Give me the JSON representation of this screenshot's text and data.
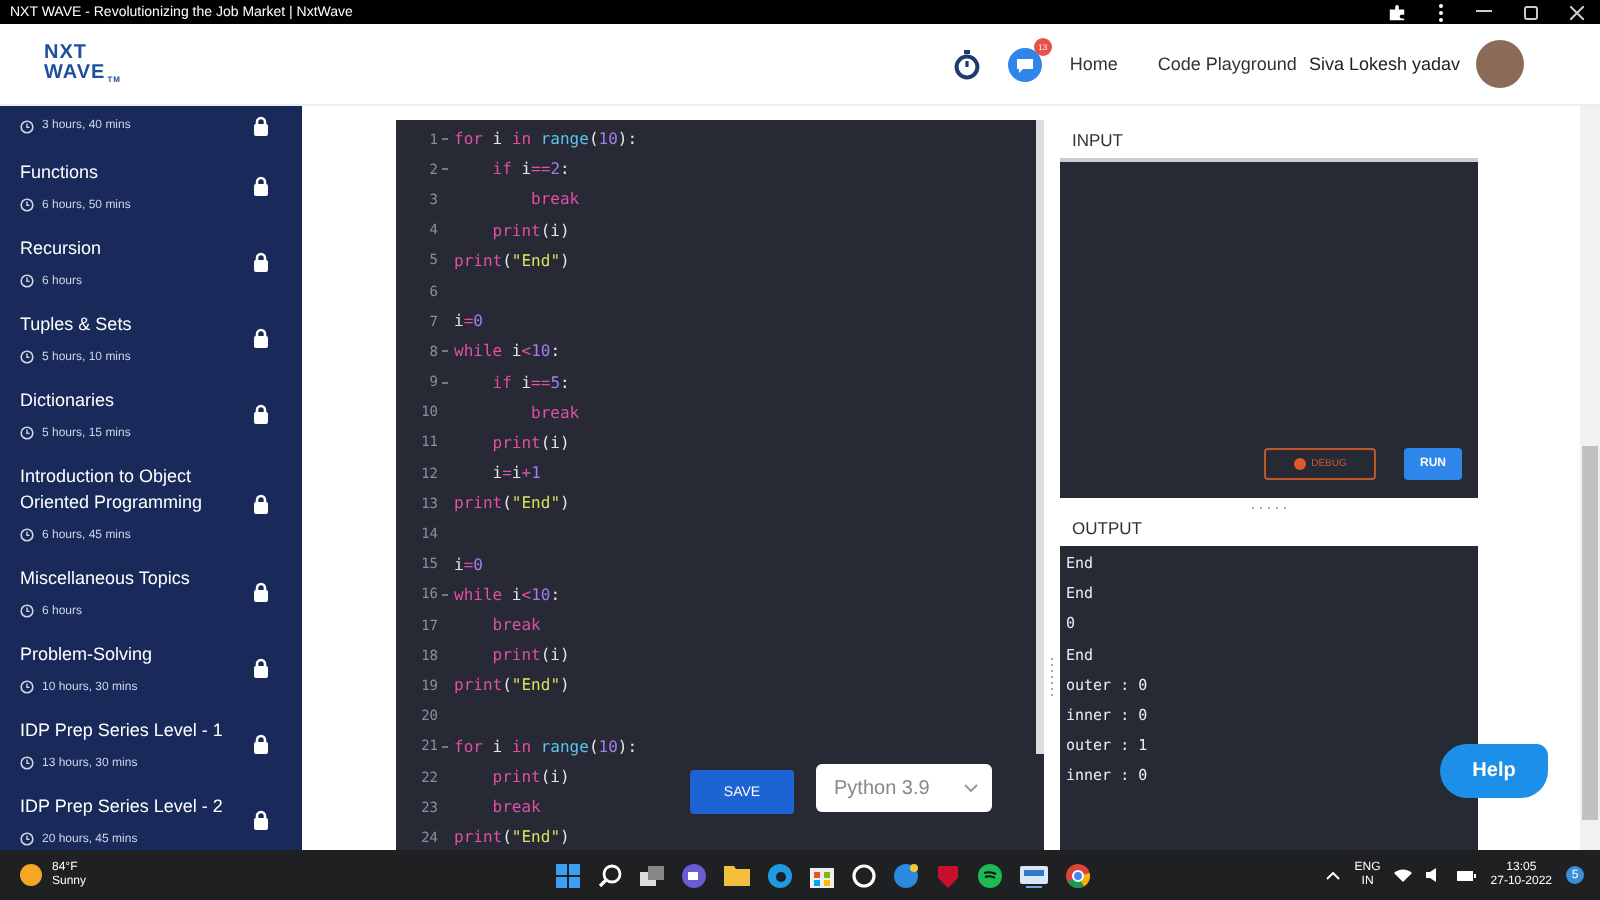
{
  "window": {
    "title": "NXT WAVE - Revolutionizing the Job Market | NxtWave"
  },
  "header": {
    "logo": {
      "line_1": "NXT",
      "line_2": "WAVE",
      "mark": "TM"
    },
    "chat_badge": "13",
    "nav": [
      "Home",
      "Code Playground"
    ],
    "user_name": "Siva Lokesh yadav"
  },
  "sidebar": {
    "items": [
      {
        "duration": "3 hours, 40 mins",
        "locked": true
      },
      {
        "title": "Functions",
        "duration": "6 hours, 50 mins",
        "locked": true
      },
      {
        "title": "Recursion",
        "duration": "6 hours",
        "locked": true
      },
      {
        "title": "Tuples & Sets",
        "duration": "5 hours, 10 mins",
        "locked": true
      },
      {
        "title": "Dictionaries",
        "duration": "5 hours, 15 mins",
        "locked": true
      },
      {
        "title": "Introduction to Object Oriented Programming",
        "duration": "6 hours, 45 mins",
        "locked": true
      },
      {
        "title": "Miscellaneous Topics",
        "duration": "6 hours",
        "locked": true
      },
      {
        "title": "Problem-Solving",
        "duration": "10 hours, 30 mins",
        "locked": true
      },
      {
        "title": "IDP Prep Series Level - 1",
        "duration": "13 hours, 30 mins",
        "locked": true
      },
      {
        "title": "IDP Prep Series Level - 2",
        "duration": "20 hours, 45 mins",
        "locked": true
      }
    ]
  },
  "editor": {
    "lines": [
      {
        "number": "1",
        "fold": true,
        "tokens": [
          {
            "text": "for ",
            "kind": "keyword"
          },
          {
            "text": "i ",
            "kind": "name"
          },
          {
            "text": "in ",
            "kind": "keyword"
          },
          {
            "text": "range",
            "kind": "builtin"
          },
          {
            "text": "(",
            "kind": "name"
          },
          {
            "text": "10",
            "kind": "number"
          },
          {
            "text": "):",
            "kind": "name"
          }
        ]
      },
      {
        "number": "2",
        "fold": true,
        "tokens": [
          {
            "text": "    if ",
            "kind": "keyword"
          },
          {
            "text": "i",
            "kind": "name"
          },
          {
            "text": "==",
            "kind": "keyword"
          },
          {
            "text": "2",
            "kind": "number"
          },
          {
            "text": ":",
            "kind": "name"
          }
        ]
      },
      {
        "number": "3",
        "fold": false,
        "tokens": [
          {
            "text": "        break",
            "kind": "keyword"
          }
        ]
      },
      {
        "number": "4",
        "fold": false,
        "tokens": [
          {
            "text": "    print",
            "kind": "keyword"
          },
          {
            "text": "(i)",
            "kind": "name"
          }
        ]
      },
      {
        "number": "5",
        "fold": false,
        "tokens": [
          {
            "text": "print",
            "kind": "keyword"
          },
          {
            "text": "(",
            "kind": "name"
          },
          {
            "text": "\"End\"",
            "kind": "string"
          },
          {
            "text": ")",
            "kind": "name"
          }
        ]
      },
      {
        "number": "6",
        "fold": false
      },
      {
        "number": "7",
        "fold": false,
        "tokens": [
          {
            "text": "i",
            "kind": "name"
          },
          {
            "text": "=",
            "kind": "keyword"
          },
          {
            "text": "0",
            "kind": "number"
          }
        ]
      },
      {
        "number": "8",
        "fold": true,
        "tokens": [
          {
            "text": "while ",
            "kind": "keyword"
          },
          {
            "text": "i",
            "kind": "name"
          },
          {
            "text": "<",
            "kind": "keyword"
          },
          {
            "text": "10",
            "kind": "number"
          },
          {
            "text": ":",
            "kind": "name"
          }
        ]
      },
      {
        "number": "9",
        "fold": true,
        "tokens": [
          {
            "text": "    if ",
            "kind": "keyword"
          },
          {
            "text": "i",
            "kind": "name"
          },
          {
            "text": "==",
            "kind": "keyword"
          },
          {
            "text": "5",
            "kind": "number"
          },
          {
            "text": ":",
            "kind": "name"
          }
        ]
      },
      {
        "number": "10",
        "fold": false,
        "tokens": [
          {
            "text": "        break",
            "kind": "keyword"
          }
        ]
      },
      {
        "number": "11",
        "fold": false,
        "tokens": [
          {
            "text": "    print",
            "kind": "keyword"
          },
          {
            "text": "(i)",
            "kind": "name"
          }
        ]
      },
      {
        "number": "12",
        "fold": false,
        "tokens": [
          {
            "text": "    i",
            "kind": "name"
          },
          {
            "text": "=",
            "kind": "keyword"
          },
          {
            "text": "i",
            "kind": "name"
          },
          {
            "text": "+",
            "kind": "keyword"
          },
          {
            "text": "1",
            "kind": "number"
          }
        ]
      },
      {
        "number": "13",
        "fold": false,
        "tokens": [
          {
            "text": "print",
            "kind": "keyword"
          },
          {
            "text": "(",
            "kind": "name"
          },
          {
            "text": "\"End\"",
            "kind": "string"
          },
          {
            "text": ")",
            "kind": "name"
          }
        ]
      },
      {
        "number": "14",
        "fold": false
      },
      {
        "number": "15",
        "fold": false,
        "tokens": [
          {
            "text": "i",
            "kind": "name"
          },
          {
            "text": "=",
            "kind": "keyword"
          },
          {
            "text": "0",
            "kind": "number"
          }
        ]
      },
      {
        "number": "16",
        "fold": true,
        "tokens": [
          {
            "text": "while ",
            "kind": "keyword"
          },
          {
            "text": "i",
            "kind": "name"
          },
          {
            "text": "<",
            "kind": "keyword"
          },
          {
            "text": "10",
            "kind": "number"
          },
          {
            "text": ":",
            "kind": "name"
          }
        ]
      },
      {
        "number": "17",
        "fold": false,
        "tokens": [
          {
            "text": "    break",
            "kind": "keyword"
          }
        ]
      },
      {
        "number": "18",
        "fold": false,
        "tokens": [
          {
            "text": "    print",
            "kind": "keyword"
          },
          {
            "text": "(i)",
            "kind": "name"
          }
        ]
      },
      {
        "number": "19",
        "fold": false,
        "tokens": [
          {
            "text": "print",
            "kind": "keyword"
          },
          {
            "text": "(",
            "kind": "name"
          },
          {
            "text": "\"End\"",
            "kind": "string"
          },
          {
            "text": ")",
            "kind": "name"
          }
        ]
      },
      {
        "number": "20",
        "fold": false
      },
      {
        "number": "21",
        "fold": true,
        "tokens": [
          {
            "text": "for ",
            "kind": "keyword"
          },
          {
            "text": "i ",
            "kind": "name"
          },
          {
            "text": "in ",
            "kind": "keyword"
          },
          {
            "text": "range",
            "kind": "builtin"
          },
          {
            "text": "(",
            "kind": "name"
          },
          {
            "text": "10",
            "kind": "number"
          },
          {
            "text": "):",
            "kind": "name"
          }
        ]
      },
      {
        "number": "22",
        "fold": false,
        "tokens": [
          {
            "text": "    print",
            "kind": "keyword"
          },
          {
            "text": "(i)",
            "kind": "name"
          }
        ]
      },
      {
        "number": "23",
        "fold": false,
        "tokens": [
          {
            "text": "    break",
            "kind": "keyword"
          }
        ]
      },
      {
        "number": "24",
        "fold": false,
        "tokens": [
          {
            "text": "print",
            "kind": "keyword"
          },
          {
            "text": "(",
            "kind": "name"
          },
          {
            "text": "\"End\"",
            "kind": "string"
          },
          {
            "text": ")",
            "kind": "name"
          }
        ]
      }
    ],
    "save_button": "SAVE",
    "language": "Python 3.9"
  },
  "input": {
    "label": "INPUT",
    "debug_button": "DEBUG",
    "run_button": "RUN"
  },
  "output": {
    "label": "OUTPUT",
    "lines": [
      "End",
      "End",
      "0",
      "End",
      "outer : 0",
      "inner : 0",
      "outer : 1",
      "inner : 0"
    ]
  },
  "help_button": "Help",
  "taskbar": {
    "temperature": "84°F",
    "weather": "Sunny",
    "language": "ENG",
    "region": "IN",
    "time": "13:05",
    "date": "27-10-2022",
    "notification_count": "5"
  }
}
